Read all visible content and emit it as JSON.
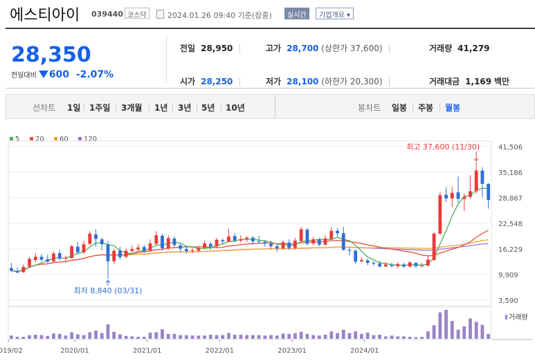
{
  "header": {
    "title": "에스티아이",
    "code": "039440",
    "market": "코스닥",
    "datetime": "2024.01.26 09:40 기준(장중)",
    "realtime": "실시간",
    "company_info": "기업개요 ▾"
  },
  "price": {
    "current": "28,350",
    "change_label": "전일대비",
    "change": "600",
    "change_pct": "-2.07%"
  },
  "stats": {
    "prev_close_label": "전일",
    "prev_close": "28,950",
    "open_label": "시가",
    "open": "28,250",
    "high_label": "고가",
    "high": "28,700",
    "upper_limit": "(상한가 37,600)",
    "low_label": "저가",
    "low": "28,100",
    "lower_limit": "(하한가 20,300)",
    "volume_label": "거래량",
    "volume": "41,279",
    "amount_label": "거래대금",
    "amount": "1,169",
    "amount_unit": "백만"
  },
  "periods": {
    "line_label": "선차트",
    "line_items": [
      "1일",
      "1주일",
      "3개월",
      "1년",
      "3년",
      "5년",
      "10년"
    ],
    "candle_label": "봉차트",
    "candle_items": [
      "일봉",
      "주봉",
      "월봉"
    ],
    "active_candle": "월봉"
  },
  "colors": {
    "up": "#e83a3a",
    "down": "#2f6fd6",
    "ma5": "#4caf50",
    "ma20": "#e8503a",
    "ma60": "#f0a030",
    "ma120": "#a070d0",
    "volume": "#9a84c8"
  },
  "chart_data": {
    "type": "candlestick",
    "interval": "monthly",
    "legend": [
      "5",
      "20",
      "60",
      "120"
    ],
    "y_ticks": [
      "41,506",
      "35,186",
      "28,867",
      "22,548",
      "16,229",
      "9,909",
      "3,590"
    ],
    "x_ticks": [
      "2019/02",
      "2020/01",
      "2021/01",
      "2022/01",
      "2023/01",
      "2024/01"
    ],
    "ylim": [
      3590,
      41506
    ],
    "annotations": {
      "high": {
        "text": "최고 37,600 (11/30)",
        "value": 37600
      },
      "low": {
        "text": "최저 8,840 (03/31)",
        "value": 8840
      }
    },
    "volume_label": "거래량",
    "candles": [
      [
        11500,
        10900,
        12800,
        10500
      ],
      [
        10800,
        10400,
        11600,
        10200
      ],
      [
        10500,
        11800,
        12400,
        10300
      ],
      [
        11900,
        13800,
        14200,
        11600
      ],
      [
        13500,
        14300,
        15200,
        12900
      ],
      [
        14300,
        13600,
        15000,
        13100
      ],
      [
        13700,
        13100,
        14800,
        12800
      ],
      [
        13200,
        15100,
        15600,
        12900
      ],
      [
        15200,
        13900,
        16000,
        13400
      ],
      [
        13900,
        14000,
        14600,
        13100
      ],
      [
        14000,
        16900,
        17200,
        13800
      ],
      [
        16800,
        15400,
        18000,
        15100
      ],
      [
        15400,
        17400,
        18200,
        15000
      ],
      [
        17500,
        20000,
        20600,
        17200
      ],
      [
        19800,
        18700,
        21100,
        16800
      ],
      [
        18600,
        17400,
        19000,
        15900
      ],
      [
        17300,
        13200,
        18200,
        8840
      ],
      [
        13200,
        15800,
        16200,
        12600
      ],
      [
        15800,
        14200,
        16800,
        13600
      ],
      [
        14300,
        15800,
        16300,
        13900
      ],
      [
        15700,
        16200,
        17100,
        15000
      ],
      [
        16100,
        16600,
        17400,
        15600
      ],
      [
        16700,
        15800,
        17200,
        15200
      ],
      [
        15900,
        17600,
        18600,
        15500
      ],
      [
        17500,
        19600,
        20600,
        17100
      ],
      [
        19500,
        16400,
        20000,
        15800
      ],
      [
        16400,
        18900,
        19600,
        16000
      ],
      [
        18800,
        17200,
        19300,
        16600
      ],
      [
        17100,
        16300,
        17800,
        15400
      ],
      [
        16200,
        15700,
        16900,
        15100
      ],
      [
        15700,
        15900,
        16500,
        15200
      ],
      [
        15800,
        16500,
        17000,
        15500
      ],
      [
        16500,
        17600,
        18300,
        16200
      ],
      [
        17500,
        16800,
        18000,
        16000
      ],
      [
        16900,
        18500,
        18900,
        16400
      ],
      [
        18400,
        18100,
        18900,
        17400
      ],
      [
        18100,
        19300,
        21200,
        18000
      ],
      [
        19400,
        18300,
        20100,
        17900
      ],
      [
        18300,
        18600,
        19600,
        17800
      ],
      [
        18600,
        19000,
        19400,
        17900
      ],
      [
        19000,
        18100,
        19400,
        17300
      ],
      [
        18100,
        18000,
        19500,
        17500
      ],
      [
        18000,
        17600,
        18400,
        16800
      ],
      [
        17500,
        16900,
        18300,
        16300
      ],
      [
        16900,
        16400,
        17500,
        15500
      ],
      [
        16400,
        17900,
        18400,
        16000
      ],
      [
        17800,
        16500,
        18600,
        16000
      ],
      [
        16500,
        18300,
        19000,
        16100
      ],
      [
        18200,
        21100,
        21600,
        17900
      ],
      [
        21000,
        17500,
        21400,
        17100
      ],
      [
        17600,
        18600,
        19200,
        17000
      ],
      [
        18600,
        17300,
        19000,
        16900
      ],
      [
        17300,
        18800,
        19700,
        17000
      ],
      [
        18700,
        20700,
        21600,
        18400
      ],
      [
        20700,
        20100,
        21400,
        19300
      ],
      [
        20100,
        16000,
        21700,
        15800
      ],
      [
        16000,
        15800,
        16600,
        14600
      ],
      [
        15800,
        13100,
        16100,
        12500
      ],
      [
        13200,
        13500,
        14200,
        12800
      ],
      [
        13400,
        12800,
        13900,
        12200
      ],
      [
        12800,
        12600,
        13200,
        12100
      ],
      [
        12600,
        11900,
        13300,
        11700
      ],
      [
        11900,
        12400,
        13000,
        11800
      ],
      [
        12300,
        12000,
        12900,
        11600
      ],
      [
        12000,
        12500,
        12900,
        11400
      ],
      [
        12400,
        11900,
        12800,
        11500
      ],
      [
        11900,
        12900,
        13200,
        11600
      ],
      [
        12800,
        12000,
        13000,
        11500
      ],
      [
        12000,
        12100,
        12800,
        11700
      ],
      [
        12100,
        13600,
        14600,
        12000
      ],
      [
        13500,
        20000,
        20400,
        13300
      ],
      [
        20000,
        29500,
        30200,
        19800
      ],
      [
        29600,
        28700,
        31500,
        27800
      ],
      [
        28700,
        30100,
        31600,
        26600
      ],
      [
        30200,
        28600,
        34100,
        27700
      ],
      [
        28600,
        29100,
        29900,
        25600
      ],
      [
        29100,
        30500,
        34500,
        28600
      ],
      [
        30500,
        35600,
        37600,
        29900
      ],
      [
        35600,
        32300,
        36400,
        29100
      ],
      [
        32300,
        28350,
        32500,
        26200
      ]
    ],
    "volume": [
      8,
      5,
      5,
      9,
      10,
      9,
      7,
      13,
      12,
      8,
      16,
      11,
      9,
      16,
      20,
      14,
      35,
      17,
      11,
      7,
      6,
      5,
      5,
      15,
      16,
      23,
      12,
      12,
      9,
      9,
      8,
      8,
      8,
      10,
      9,
      9,
      14,
      10,
      10,
      9,
      9,
      9,
      8,
      9,
      8,
      13,
      12,
      14,
      17,
      12,
      9,
      8,
      10,
      18,
      14,
      22,
      14,
      18,
      12,
      15,
      9,
      10,
      6,
      8,
      6,
      6,
      5,
      4,
      5,
      18,
      33,
      64,
      70,
      43,
      22,
      30,
      49,
      41,
      34,
      12
    ]
  }
}
